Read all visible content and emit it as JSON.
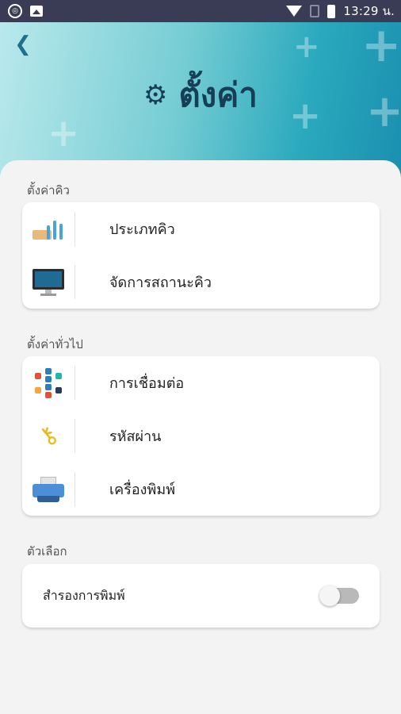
{
  "status_bar": {
    "time": "13:29 น.",
    "icons": [
      "notification-icon",
      "image-icon",
      "wifi-icon",
      "sim-icon",
      "battery-icon"
    ]
  },
  "header": {
    "back_icon": "back-arrow-icon",
    "title": "ตั้งค่า",
    "title_icon": "gear-icon",
    "gradient_colors": [
      "#b9e9ec",
      "#74ccd3",
      "#2aa9bd",
      "#1a8fb0"
    ]
  },
  "sections": {
    "queue": {
      "label": "ตั้งค่าคิว",
      "items": [
        {
          "label": "ประเภทคิว",
          "icon": "queue-type-icon"
        },
        {
          "label": "จัดการสถานะคิว",
          "icon": "monitor-icon"
        }
      ]
    },
    "general": {
      "label": "ตั้งค่าทั่วไป",
      "items": [
        {
          "label": "การเชื่อมต่อ",
          "icon": "connection-icon"
        },
        {
          "label": "รหัสผ่าน",
          "icon": "key-icon"
        },
        {
          "label": "เครื่องพิมพ์",
          "icon": "printer-icon"
        }
      ]
    },
    "options": {
      "label": "ตัวเลือก",
      "toggle_label": "สำรองการพิมพ์",
      "toggle_on": false
    }
  },
  "colors": {
    "status_bar": "#3a3b55",
    "title_text": "#163e57",
    "background": "#f3f3f3"
  }
}
